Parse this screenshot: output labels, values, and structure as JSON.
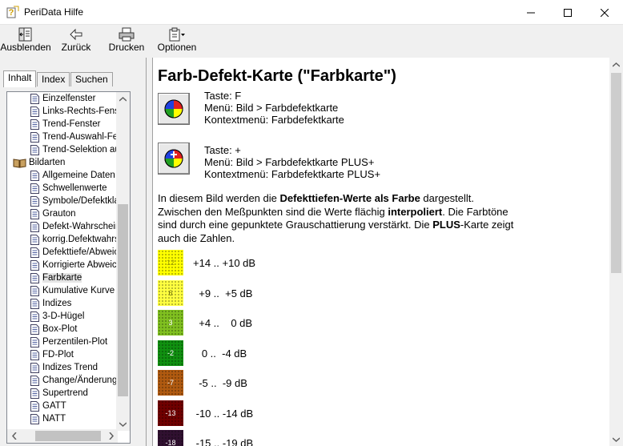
{
  "window": {
    "title": "PeriData Hilfe"
  },
  "toolbar": {
    "hide": "Ausblenden",
    "back": "Zurück",
    "print": "Drucken",
    "options": "Optionen"
  },
  "tabs": {
    "contents": "Inhalt",
    "index": "Index",
    "search": "Suchen"
  },
  "tree": [
    {
      "label": "Einzelfenster",
      "kind": "page"
    },
    {
      "label": "Links-Rechts-Fenster",
      "kind": "page"
    },
    {
      "label": "Trend-Fenster",
      "kind": "page"
    },
    {
      "label": "Trend-Auswahl-Fenster",
      "kind": "page"
    },
    {
      "label": "Trend-Selektion auswählen",
      "kind": "page"
    },
    {
      "label": "Bildarten",
      "kind": "book"
    },
    {
      "label": "Allgemeine Daten",
      "kind": "page"
    },
    {
      "label": "Schwellenwerte",
      "kind": "page"
    },
    {
      "label": "Symbole/Defektklassen",
      "kind": "page"
    },
    {
      "label": "Grauton",
      "kind": "page"
    },
    {
      "label": "Defekt-Wahrscheinlichkeit",
      "kind": "page"
    },
    {
      "label": "korrig.Defektwahrscheinlichkeit",
      "kind": "page"
    },
    {
      "label": "Defekttiefe/Abweichung",
      "kind": "page"
    },
    {
      "label": "Korrigierte Abweichung",
      "kind": "page"
    },
    {
      "label": "Farbkarte",
      "kind": "page",
      "selected": true
    },
    {
      "label": "Kumulative Kurve",
      "kind": "page"
    },
    {
      "label": "Indizes",
      "kind": "page"
    },
    {
      "label": "3-D-Hügel",
      "kind": "page"
    },
    {
      "label": "Box-Plot",
      "kind": "page"
    },
    {
      "label": "Perzentilen-Plot",
      "kind": "page"
    },
    {
      "label": "FD-Plot",
      "kind": "page"
    },
    {
      "label": "Indizes Trend",
      "kind": "page"
    },
    {
      "label": "Change/Änderung",
      "kind": "page"
    },
    {
      "label": "Supertrend",
      "kind": "page"
    },
    {
      "label": "GATT",
      "kind": "page"
    },
    {
      "label": "NATT",
      "kind": "page"
    }
  ],
  "content": {
    "heading": "Farb-Defekt-Karte (\"Farbkarte\")",
    "block1": {
      "line1": "Taste: F",
      "line2": "Menü: Bild > Farbdefektkarte",
      "line3": "Kontextmenü: Farbdefektkarte"
    },
    "block2": {
      "line1": "Taste: +",
      "line2": "Menü: Bild > Farbdefektkarte PLUS+",
      "line3": "Kontextmenü: Farbdefektkarte PLUS+"
    },
    "para": {
      "t1": "In diesem Bild werden die ",
      "b1": "Defekttiefen-Werte als Farbe",
      "t2": " dargestellt. Zwischen den Meßpunkten sind die Werte flächig ",
      "b2": "interpoliert",
      "t3": ". Die Farbtöne sind durch eine gepunktete Grauschattierung verstärkt. Die ",
      "b3": "PLUS",
      "t4": "-Karte zeigt auch die Zahlen."
    },
    "legend": [
      {
        "num": "12",
        "range": "+14 .. +10 dB",
        "bg": "#ffff00",
        "fg": "#a0a000"
      },
      {
        "num": "6",
        "range": "  +9 ..  +5 dB",
        "bg": "#ffff40",
        "fg": "#6a6a00"
      },
      {
        "num": "3",
        "range": "  +4 ..    0 dB",
        "bg": "#80c020",
        "fg": "#ffffff"
      },
      {
        "num": "-2",
        "range": "   0 ..  -4 dB",
        "bg": "#109010",
        "fg": "#ffffff"
      },
      {
        "num": "-7",
        "range": "  -5 ..  -9 dB",
        "bg": "#b05a10",
        "fg": "#ffffff"
      },
      {
        "num": "-13",
        "range": " -10 .. -14 dB",
        "bg": "#700000",
        "fg": "#ffffff"
      },
      {
        "num": "-18",
        "range": " -15 .. -19 dB",
        "bg": "#301030",
        "fg": "#ffffff"
      }
    ]
  }
}
